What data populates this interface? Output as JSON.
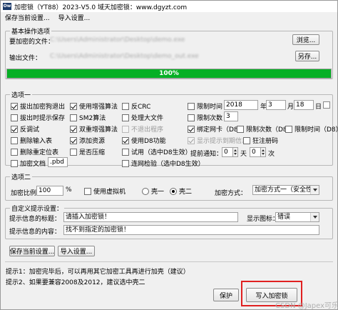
{
  "window": {
    "title": "加密锁（YT88）2023-V5.0 域天加密锁：www.dgyzt.com",
    "app_icon_text": "Ow"
  },
  "menu": {
    "items": [
      "保存当前设置...",
      "导入设置..."
    ]
  },
  "basic": {
    "group_title": "基本操作选项",
    "encrypt_file_label": "要加密的文件：",
    "encrypt_file_value": "C:\\Users\\Administrator\\Desktop\\demo.exe",
    "browse_button": "浏览...",
    "output_file_label": "输出文件：",
    "output_file_value": "C:\\Users\\Administrator\\Desktop\\demo_out.exe",
    "save_as_button": "另存...",
    "progress_percent": 100,
    "progress_text": "100%"
  },
  "options1": {
    "group_title": "选项一",
    "col1": [
      {
        "label": "拔出加密狗退出",
        "checked": true
      },
      {
        "label": "拔出时提示保存",
        "checked": false
      },
      {
        "label": "反调试",
        "checked": true
      },
      {
        "label": "删除输入表",
        "checked": false
      },
      {
        "label": "删除重定位表",
        "checked": false
      },
      {
        "label": "加密文档",
        "checked": false
      }
    ],
    "doc_ext_value": ".pbd",
    "col2": [
      {
        "label": "使用增强算法",
        "checked": true
      },
      {
        "label": "SM2算法",
        "checked": false
      },
      {
        "label": "双重增强算法",
        "checked": true
      },
      {
        "label": "添加资源",
        "checked": true
      },
      {
        "label": "是否压缩",
        "checked": false
      }
    ],
    "col3": [
      {
        "label": "反CRC",
        "checked": false,
        "disabled": false
      },
      {
        "label": "处理大文件",
        "checked": false,
        "disabled": false
      },
      {
        "label": "不退出程序",
        "checked": false,
        "disabled": true
      },
      {
        "label": "使用D8功能",
        "checked": true,
        "disabled": false
      },
      {
        "label": "试用（选中D8生效）",
        "checked": false,
        "disabled": false
      },
      {
        "label": "连网检验（选中D8生效）",
        "checked": false,
        "disabled": false
      }
    ],
    "limit_time_label": "限制时间",
    "year_value": "2018",
    "year_unit": "年",
    "month_value": "3",
    "month_unit": "月",
    "day_value": "18",
    "day_unit": "日",
    "limit_count_label": "限制次数",
    "limit_count_value": "3",
    "bind_nic_label": "绑定网卡（D8）",
    "d8_limit_count_label": "限制次数（D8）",
    "d8_limit_time_label": "限制时间（D8）",
    "show_expire_label": "显示提示到期信息",
    "show_expire_disabled": true,
    "dongle_label": "狂注册码",
    "remind_label": "提前通知：",
    "remind_days_value": "0",
    "remind_days_unit": "天",
    "remind_times_value": "0",
    "remind_times_unit": "次"
  },
  "options2": {
    "group_title": "选项二",
    "ratio_label": "加密比例",
    "ratio_value": "100",
    "ratio_unit": "%",
    "vm_label": "使用虚拟机",
    "shell1_label": "壳一",
    "shell2_label": "壳二",
    "selected_shell": 2,
    "mode_label": "加密方式：",
    "mode_value": "加密方式一（安全性高）"
  },
  "custom": {
    "group_title": "自定义提示设置：",
    "title_label": "提示信息的标题：",
    "title_value": "请插入加密锁！",
    "icon_label": "显示图标：",
    "icon_value": "错误",
    "content_label": "提示信息的内容：",
    "content_value": "找不到指定的加密锁！"
  },
  "bottom": {
    "save_settings_button": "保存当前设置...",
    "import_settings_button": "导入设置...",
    "tip1": "提示1：加密完毕后，可以再用其它加密工具再进行加壳（建议）",
    "tip2": "提示2、如果要兼容2008及2012，建议选中壳二",
    "protect_button": "保护",
    "write_button": "写入加密锁",
    "watermark": "CSDN @Japex可乐"
  }
}
